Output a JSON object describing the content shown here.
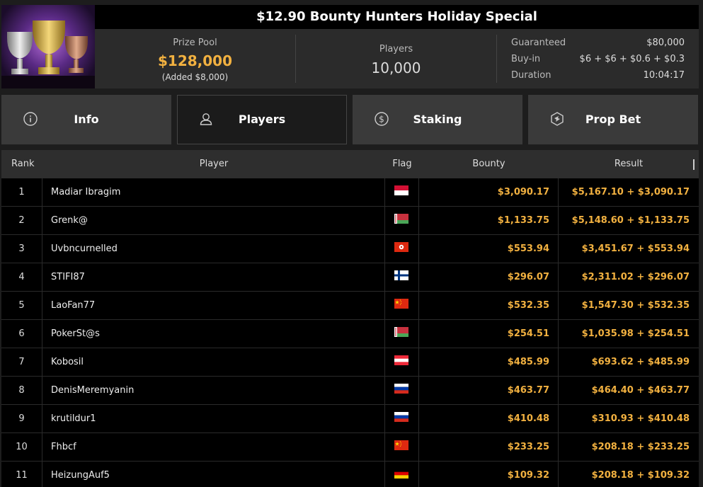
{
  "header": {
    "title": "$12.90 Bounty Hunters Holiday Special",
    "image": "trophy-cups-image",
    "prize_pool": {
      "label": "Prize Pool",
      "value": "$128,000",
      "added": "(Added $8,000)"
    },
    "players": {
      "label": "Players",
      "value": "10,000"
    },
    "details": [
      {
        "key": "Guaranteed",
        "value": "$80,000"
      },
      {
        "key": "Buy-in",
        "value": "$6 + $6 + $0.6 + $0.3"
      },
      {
        "key": "Duration",
        "value": "10:04:17"
      }
    ]
  },
  "tabs": [
    {
      "label": "Info",
      "icon": "info-icon",
      "active": false
    },
    {
      "label": "Players",
      "icon": "user-icon",
      "active": true
    },
    {
      "label": "Staking",
      "icon": "staking-dollar-icon",
      "active": false
    },
    {
      "label": "Prop Bet",
      "icon": "prop-bet-icon",
      "active": false
    }
  ],
  "table": {
    "columns": {
      "rank": "Rank",
      "player": "Player",
      "flag": "Flag",
      "bounty": "Bounty",
      "result": "Result"
    },
    "rows": [
      {
        "rank": "1",
        "player": "Madiar Ibragim",
        "flag": "monaco-indonesia",
        "bounty": "$3,090.17",
        "result": "$5,167.10 + $3,090.17"
      },
      {
        "rank": "2",
        "player": "Grenk@",
        "flag": "belarus",
        "bounty": "$1,133.75",
        "result": "$5,148.60 + $1,133.75"
      },
      {
        "rank": "3",
        "player": "Uvbncurnelled",
        "flag": "hong-kong",
        "bounty": "$553.94",
        "result": "$3,451.67 + $553.94"
      },
      {
        "rank": "4",
        "player": "STIFI87",
        "flag": "finland",
        "bounty": "$296.07",
        "result": "$2,311.02 + $296.07"
      },
      {
        "rank": "5",
        "player": "LaoFan77",
        "flag": "china",
        "bounty": "$532.35",
        "result": "$1,547.30 + $532.35"
      },
      {
        "rank": "6",
        "player": "PokerSt@s",
        "flag": "belarus",
        "bounty": "$254.51",
        "result": "$1,035.98 + $254.51"
      },
      {
        "rank": "7",
        "player": "Kobosil",
        "flag": "austria",
        "bounty": "$485.99",
        "result": "$693.62 + $485.99"
      },
      {
        "rank": "8",
        "player": "DenisMeremyanin",
        "flag": "russia",
        "bounty": "$463.77",
        "result": "$464.40 + $463.77"
      },
      {
        "rank": "9",
        "player": "krutildur1",
        "flag": "russia",
        "bounty": "$410.48",
        "result": "$310.93 + $410.48"
      },
      {
        "rank": "10",
        "player": "Fhbcf",
        "flag": "china",
        "bounty": "$233.25",
        "result": "$208.18 + $233.25"
      },
      {
        "rank": "11",
        "player": "HeizungAuf5",
        "flag": "germany",
        "bounty": "$109.32",
        "result": "$208.18 + $109.32"
      }
    ]
  },
  "colors": {
    "accent": "#f2b140",
    "background": "#1d1d1d",
    "table_bg": "#000000",
    "tab_bg": "#3a3a3a"
  }
}
